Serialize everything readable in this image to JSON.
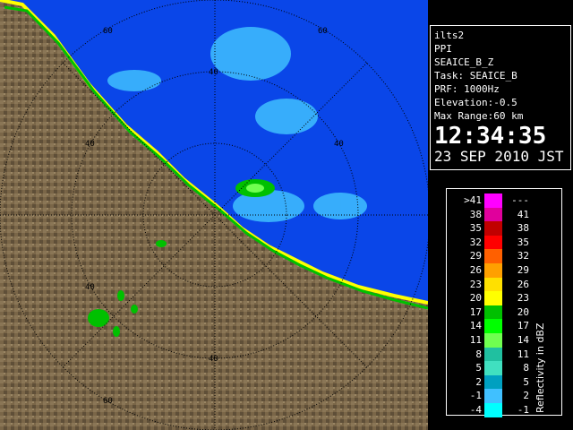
{
  "info": {
    "station": "ilts2",
    "mode": "PPI",
    "product": "SEAICE_B_Z",
    "task": "Task: SEAICE_B",
    "prf": "PRF: 1000Hz",
    "elevation": "Elevation:-0.5",
    "max_range": "Max Range:60 km",
    "time": "12:34:35",
    "date": "23 SEP 2010 JST"
  },
  "legend": {
    "unit_label": "Reflectivity in dBZ",
    "rows": [
      {
        "low": ">41",
        "high": "---",
        "color": "#ff00ff"
      },
      {
        "low": "38",
        "high": "41",
        "color": "#e0009c"
      },
      {
        "low": "35",
        "high": "38",
        "color": "#c00000"
      },
      {
        "low": "32",
        "high": "35",
        "color": "#ff0000"
      },
      {
        "low": "29",
        "high": "32",
        "color": "#ff6000"
      },
      {
        "low": "26",
        "high": "29",
        "color": "#ffa000"
      },
      {
        "low": "23",
        "high": "26",
        "color": "#ffe000"
      },
      {
        "low": "20",
        "high": "23",
        "color": "#ffff00"
      },
      {
        "low": "17",
        "high": "20",
        "color": "#00c000"
      },
      {
        "low": "14",
        "high": "17",
        "color": "#00ff00"
      },
      {
        "low": "11",
        "high": "14",
        "color": "#70ff50"
      },
      {
        "low": "8",
        "high": "11",
        "color": "#20c0a0"
      },
      {
        "low": "5",
        "high": "8",
        "color": "#40e0c0"
      },
      {
        "low": "2",
        "high": "5",
        "color": "#00a0c0"
      },
      {
        "low": "-1",
        "high": "2",
        "color": "#40c0ff"
      },
      {
        "low": "-4",
        "high": "-1",
        "color": "#00ffff"
      }
    ]
  },
  "range_labels": [
    "60",
    "60",
    "40",
    "40",
    "40",
    "40",
    "40",
    "60"
  ],
  "colors": {
    "sea": "#0a46e8",
    "land": "#7d6a4e",
    "coast_echo": "#ffff00"
  }
}
